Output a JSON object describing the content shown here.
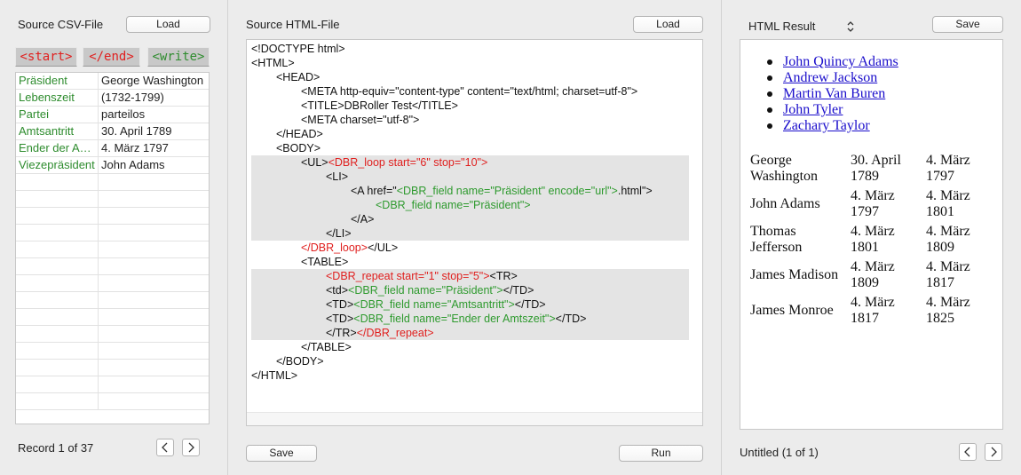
{
  "left_panel": {
    "title": "Source CSV-File",
    "load_label": "Load",
    "tags": [
      {
        "label": "<start>"
      },
      {
        "label": "</end>"
      },
      {
        "label": "<write>"
      }
    ],
    "rows": [
      {
        "key": "Präsident",
        "value": "George Washington"
      },
      {
        "key": "Lebenszeit",
        "value": "(1732-1799)"
      },
      {
        "key": "Partei",
        "value": "parteilos"
      },
      {
        "key": "Amtsantritt",
        "value": "30. April 1789"
      },
      {
        "key": "Ender der Amtszeit",
        "value": "4. März 1797"
      },
      {
        "key": "Viezepräsident",
        "value": "John Adams"
      },
      {
        "key": "",
        "value": ""
      },
      {
        "key": "",
        "value": ""
      },
      {
        "key": "",
        "value": ""
      },
      {
        "key": "",
        "value": ""
      },
      {
        "key": "",
        "value": ""
      },
      {
        "key": "",
        "value": ""
      },
      {
        "key": "",
        "value": ""
      },
      {
        "key": "",
        "value": ""
      },
      {
        "key": "",
        "value": ""
      },
      {
        "key": "",
        "value": ""
      },
      {
        "key": "",
        "value": ""
      },
      {
        "key": "",
        "value": ""
      },
      {
        "key": "",
        "value": ""
      },
      {
        "key": "",
        "value": ""
      }
    ],
    "record_status": "Record 1 of 37"
  },
  "middle_panel": {
    "title": "Source HTML-File",
    "load_label": "Load",
    "save_label": "Save",
    "run_label": "Run",
    "code_lines": [
      {
        "indent": 0,
        "hl": false,
        "segments": [
          {
            "t": "<!DOCTYPE html>",
            "c": ""
          }
        ]
      },
      {
        "indent": 0,
        "hl": false,
        "segments": [
          {
            "t": "<HTML>",
            "c": ""
          }
        ]
      },
      {
        "indent": 1,
        "hl": false,
        "segments": [
          {
            "t": "<HEAD>",
            "c": ""
          }
        ]
      },
      {
        "indent": 2,
        "hl": false,
        "segments": [
          {
            "t": "<META http-equiv=\"content-type\" content=\"text/html; charset=utf-8\">",
            "c": ""
          }
        ]
      },
      {
        "indent": 2,
        "hl": false,
        "segments": [
          {
            "t": "<TITLE>DBRoller Test</TITLE>",
            "c": ""
          }
        ]
      },
      {
        "indent": 2,
        "hl": false,
        "segments": [
          {
            "t": "<META charset=\"utf-8\">",
            "c": ""
          }
        ]
      },
      {
        "indent": 1,
        "hl": false,
        "segments": [
          {
            "t": "</HEAD>",
            "c": ""
          }
        ]
      },
      {
        "indent": 1,
        "hl": false,
        "segments": [
          {
            "t": "<BODY>",
            "c": ""
          }
        ]
      },
      {
        "indent": 2,
        "hl": true,
        "segments": [
          {
            "t": "<UL>",
            "c": ""
          },
          {
            "t": "<DBR_loop start=\"6\" stop=\"10\">",
            "c": "red"
          }
        ]
      },
      {
        "indent": 3,
        "hl": true,
        "segments": [
          {
            "t": "<LI>",
            "c": ""
          }
        ]
      },
      {
        "indent": 4,
        "hl": true,
        "segments": [
          {
            "t": "<A href=\"",
            "c": ""
          },
          {
            "t": "<DBR_field name=\"Präsident\" encode=\"url\">",
            "c": "green"
          },
          {
            "t": ".html\">",
            "c": ""
          }
        ]
      },
      {
        "indent": 5,
        "hl": true,
        "segments": [
          {
            "t": "<DBR_field name=\"Präsident\">",
            "c": "green"
          }
        ]
      },
      {
        "indent": 4,
        "hl": true,
        "segments": [
          {
            "t": "</A>",
            "c": ""
          }
        ]
      },
      {
        "indent": 3,
        "hl": true,
        "segments": [
          {
            "t": "</LI>",
            "c": ""
          }
        ]
      },
      {
        "indent": 2,
        "hl": false,
        "segments": [
          {
            "t": "</DBR_loop>",
            "c": "red"
          },
          {
            "t": "</UL>",
            "c": ""
          }
        ]
      },
      {
        "indent": 2,
        "hl": false,
        "segments": [
          {
            "t": "<TABLE>",
            "c": ""
          }
        ]
      },
      {
        "indent": 3,
        "hl": true,
        "segments": [
          {
            "t": "<DBR_repeat start=\"1\" stop=\"5\">",
            "c": "red"
          },
          {
            "t": "<TR>",
            "c": ""
          }
        ]
      },
      {
        "indent": 3,
        "hl": true,
        "segments": [
          {
            "t": "<td>",
            "c": ""
          },
          {
            "t": "<DBR_field name=\"Präsident\">",
            "c": "green"
          },
          {
            "t": "</TD>",
            "c": ""
          }
        ]
      },
      {
        "indent": 3,
        "hl": true,
        "segments": [
          {
            "t": "<TD>",
            "c": ""
          },
          {
            "t": "<DBR_field name=\"Amtsantritt\">",
            "c": "green"
          },
          {
            "t": "</TD>",
            "c": ""
          }
        ]
      },
      {
        "indent": 3,
        "hl": true,
        "segments": [
          {
            "t": "<TD>",
            "c": ""
          },
          {
            "t": "<DBR_field name=\"Ender der Amtszeit\">",
            "c": "green"
          },
          {
            "t": "</TD>",
            "c": ""
          }
        ]
      },
      {
        "indent": 3,
        "hl": true,
        "segments": [
          {
            "t": "</TR>",
            "c": ""
          },
          {
            "t": "</DBR_repeat>",
            "c": "red"
          }
        ]
      },
      {
        "indent": 2,
        "hl": false,
        "segments": [
          {
            "t": "</TABLE>",
            "c": ""
          }
        ]
      },
      {
        "indent": 1,
        "hl": false,
        "segments": [
          {
            "t": "</BODY>",
            "c": ""
          }
        ]
      },
      {
        "indent": 0,
        "hl": false,
        "segments": [
          {
            "t": "</HTML>",
            "c": ""
          }
        ]
      }
    ]
  },
  "right_panel": {
    "result_select": "HTML Result",
    "save_label": "Save",
    "links": [
      "John Quincy Adams",
      "Andrew Jackson",
      "Martin Van Buren",
      "John Tyler",
      "Zachary Taylor"
    ],
    "table": [
      {
        "president": [
          "George",
          "Washington"
        ],
        "start": [
          "30. April",
          "1789"
        ],
        "end": [
          "4. März",
          "1797"
        ]
      },
      {
        "president": [
          "John Adams"
        ],
        "start": [
          "4. März",
          "1797"
        ],
        "end": [
          "4. März",
          "1801"
        ]
      },
      {
        "president": [
          "Thomas",
          "Jefferson"
        ],
        "start": [
          "4. März",
          "1801"
        ],
        "end": [
          "4. März",
          "1809"
        ]
      },
      {
        "president": [
          "James Madison"
        ],
        "start": [
          "4. März",
          "1809"
        ],
        "end": [
          "4. März",
          "1817"
        ]
      },
      {
        "president": [
          "James Monroe"
        ],
        "start": [
          "4. März",
          "1817"
        ],
        "end": [
          "4. März",
          "1825"
        ]
      }
    ],
    "doc_status": "Untitled (1 of 1)"
  },
  "colors": {
    "field_green": "#2e8c2e",
    "tag_red": "#e0201f",
    "link_blue": "#1a0dcb",
    "highlight": "#e4e4e4"
  },
  "icons": {
    "prev": "chevron-left-icon",
    "next": "chevron-right-icon",
    "select": "up-down-arrows-icon"
  }
}
